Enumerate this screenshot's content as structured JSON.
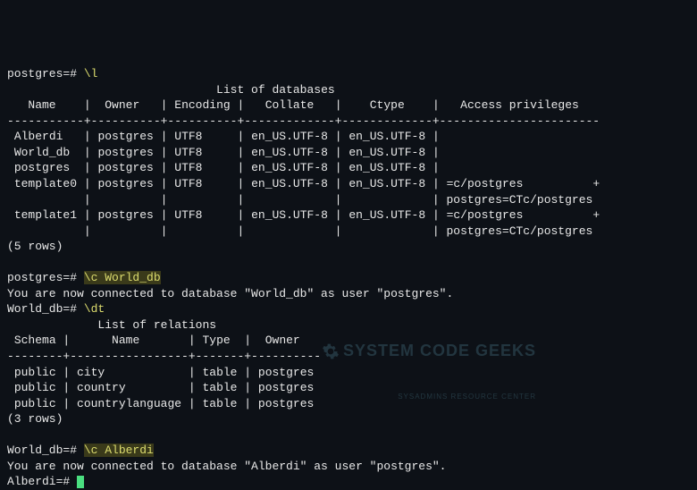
{
  "prompts": {
    "postgres": "postgres=#",
    "world_db": "World_db=#",
    "alberdi": "Alberdi=#"
  },
  "commands": {
    "list_db": "\\l",
    "connect_world": "\\c World_db",
    "list_tables": "\\dt",
    "connect_alberdi": "\\c Alberdi"
  },
  "databases": {
    "title": "List of databases",
    "headers": {
      "name": "Name",
      "owner": "Owner",
      "encoding": "Encoding",
      "collate": "Collate",
      "ctype": "Ctype",
      "access": "Access privileges"
    },
    "sep": "-----------+----------+----------+-------------+-------------+-----------------------",
    "rows": [
      {
        "name": "Alberdi",
        "owner": "postgres",
        "encoding": "UTF8",
        "collate": "en_US.UTF-8",
        "ctype": "en_US.UTF-8",
        "access": ""
      },
      {
        "name": "World_db",
        "owner": "postgres",
        "encoding": "UTF8",
        "collate": "en_US.UTF-8",
        "ctype": "en_US.UTF-8",
        "access": ""
      },
      {
        "name": "postgres",
        "owner": "postgres",
        "encoding": "UTF8",
        "collate": "en_US.UTF-8",
        "ctype": "en_US.UTF-8",
        "access": ""
      },
      {
        "name": "template0",
        "owner": "postgres",
        "encoding": "UTF8",
        "collate": "en_US.UTF-8",
        "ctype": "en_US.UTF-8",
        "access": "=c/postgres          +",
        "access2": "postgres=CTc/postgres"
      },
      {
        "name": "template1",
        "owner": "postgres",
        "encoding": "UTF8",
        "collate": "en_US.UTF-8",
        "ctype": "en_US.UTF-8",
        "access": "=c/postgres          +",
        "access2": "postgres=CTc/postgres"
      }
    ],
    "count": "(5 rows)"
  },
  "messages": {
    "connected_world": "You are now connected to database \"World_db\" as user \"postgres\".",
    "connected_alberdi": "You are now connected to database \"Alberdi\" as user \"postgres\"."
  },
  "relations": {
    "title": "List of relations",
    "headers": {
      "schema": "Schema",
      "name": "Name",
      "type": "Type",
      "owner": "Owner"
    },
    "sep": "--------+-----------------+-------+----------",
    "rows": [
      {
        "schema": "public",
        "name": "city",
        "type": "table",
        "owner": "postgres"
      },
      {
        "schema": "public",
        "name": "country",
        "type": "table",
        "owner": "postgres"
      },
      {
        "schema": "public",
        "name": "countrylanguage",
        "type": "table",
        "owner": "postgres"
      }
    ],
    "count": "(3 rows)"
  },
  "watermark": {
    "main": "SYSTEM CODE GEEKS",
    "sub": "SYSADMINS RESOURCE CENTER"
  }
}
